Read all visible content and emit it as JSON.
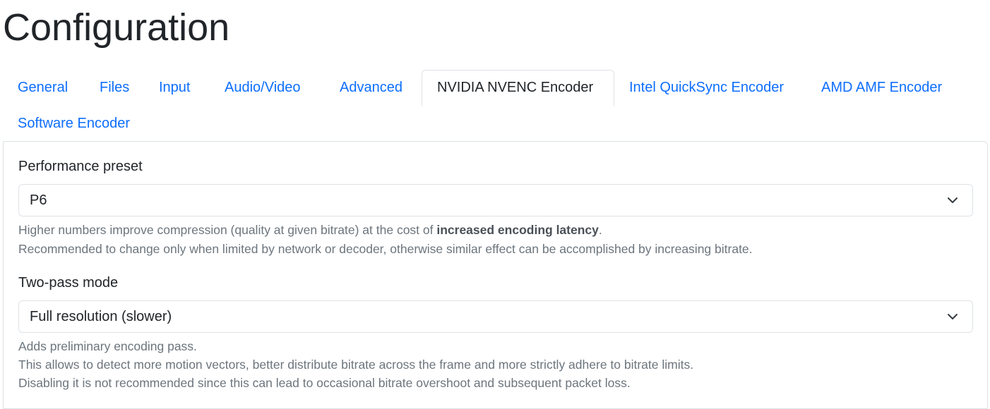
{
  "page": {
    "title": "Configuration"
  },
  "tabs": [
    {
      "label": "General"
    },
    {
      "label": "Files"
    },
    {
      "label": "Input"
    },
    {
      "label": "Audio/Video"
    },
    {
      "label": "Advanced"
    },
    {
      "label": "NVIDIA NVENC Encoder",
      "active": true
    },
    {
      "label": "Intel QuickSync Encoder"
    },
    {
      "label": "AMD AMF Encoder"
    },
    {
      "label": "Software Encoder"
    }
  ],
  "performance_preset": {
    "label": "Performance preset",
    "value": "P6",
    "help": {
      "line1_prefix": "Higher numbers improve compression (quality at given bitrate) at the cost of ",
      "line1_bold": "increased encoding latency",
      "line1_suffix": ".",
      "line2": "Recommended to change only when limited by network or decoder, otherwise similar effect can be accomplished by increasing bitrate."
    }
  },
  "two_pass_mode": {
    "label": "Two-pass mode",
    "value": "Full resolution (slower)",
    "help": {
      "line1": "Adds preliminary encoding pass.",
      "line2": "This allows to detect more motion vectors, better distribute bitrate across the frame and more strictly adhere to bitrate limits.",
      "line3": "Disabling it is not recommended since this can lead to occasional bitrate overshoot and subsequent packet loss."
    }
  },
  "icons": {
    "dropdown": "chevron-down-icon"
  },
  "colors": {
    "link": "#0d6efd",
    "text": "#212529",
    "muted": "#6c757d",
    "border": "#dee2e6"
  }
}
